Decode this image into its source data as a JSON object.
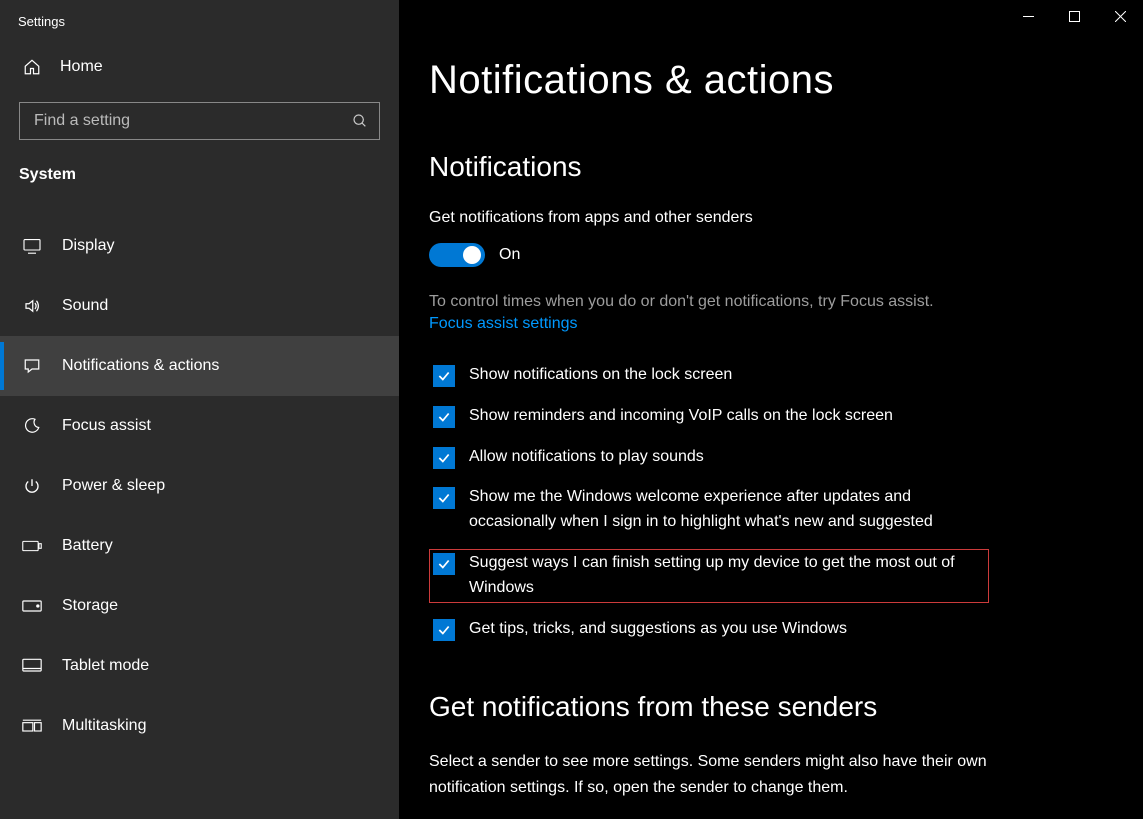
{
  "window": {
    "title": "Settings"
  },
  "sidebar": {
    "home_label": "Home",
    "search_placeholder": "Find a setting",
    "category_label": "System",
    "items": [
      {
        "label": "Display"
      },
      {
        "label": "Sound"
      },
      {
        "label": "Notifications & actions"
      },
      {
        "label": "Focus assist"
      },
      {
        "label": "Power & sleep"
      },
      {
        "label": "Battery"
      },
      {
        "label": "Storage"
      },
      {
        "label": "Tablet mode"
      },
      {
        "label": "Multitasking"
      }
    ]
  },
  "main": {
    "page_title": "Notifications & actions",
    "notifications": {
      "section_title": "Notifications",
      "toggle_label": "Get notifications from apps and other senders",
      "toggle_state": "On",
      "helper_text": "To control times when you do or don't get notifications, try Focus assist.",
      "helper_link": "Focus assist settings",
      "checks": [
        {
          "label": "Show notifications on the lock screen"
        },
        {
          "label": "Show reminders and incoming VoIP calls on the lock screen"
        },
        {
          "label": "Allow notifications to play sounds"
        },
        {
          "label": "Show me the Windows welcome experience after updates and occasionally when I sign in to highlight what's new and suggested"
        },
        {
          "label": "Suggest ways I can finish setting up my device to get the most out of Windows"
        },
        {
          "label": "Get tips, tricks, and suggestions as you use Windows"
        }
      ]
    },
    "senders": {
      "title": "Get notifications from these senders",
      "desc": "Select a sender to see more settings. Some senders might also have their own notification settings. If so, open the sender to change them."
    }
  },
  "colors": {
    "accent": "#0078d4",
    "link": "#0099ff",
    "highlight_border": "#cc3b3b"
  }
}
